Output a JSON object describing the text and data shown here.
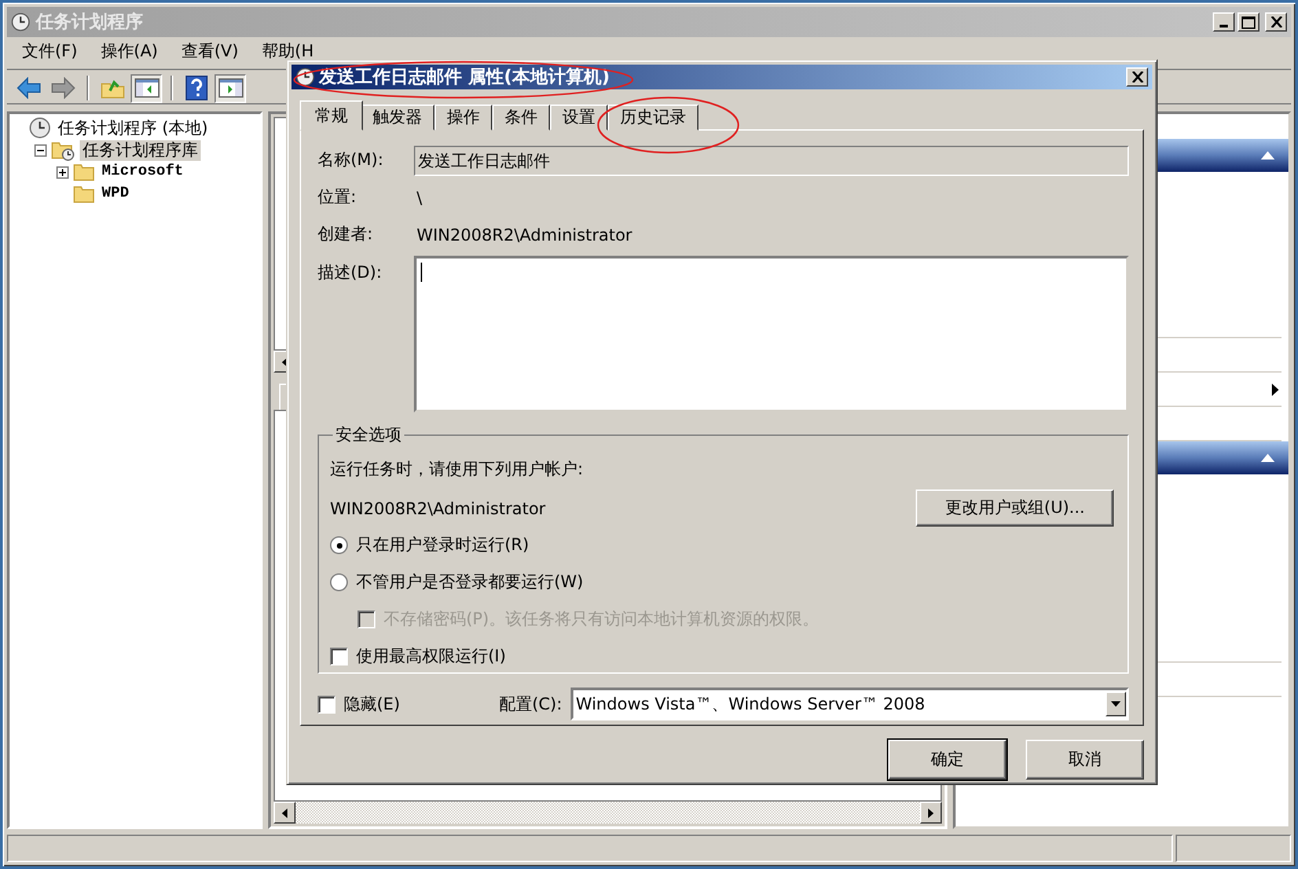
{
  "window": {
    "title": "任务计划程序"
  },
  "menu": [
    "文件(F)",
    "操作(A)",
    "查看(V)",
    "帮助(H"
  ],
  "tree": [
    {
      "label": "任务计划程序 (本地)",
      "kind": "root",
      "selected": false,
      "children": [
        {
          "label": "任务计划程序库",
          "kind": "library",
          "expanded": true,
          "selected": true,
          "children": [
            {
              "label": "Microsoft",
              "kind": "folder",
              "expanded": false,
              "selected": false
            },
            {
              "label": "WPD",
              "kind": "folder",
              "selected": false
            }
          ]
        }
      ]
    }
  ],
  "dialog": {
    "title": "发送工作日志邮件 属性(本地计算机)",
    "title_highlighted": true,
    "tabs": [
      {
        "label": "常规",
        "selected": true,
        "highlighted": false
      },
      {
        "label": "触发器",
        "selected": false,
        "highlighted": false
      },
      {
        "label": "操作",
        "selected": false,
        "highlighted": false
      },
      {
        "label": "条件",
        "selected": false,
        "highlighted": false
      },
      {
        "label": "设置",
        "selected": false,
        "highlighted": false
      },
      {
        "label": "历史记录",
        "selected": false,
        "highlighted": true
      }
    ],
    "name_label": "名称(M):",
    "name_value": "发送工作日志邮件",
    "location_label": "位置:",
    "location_value": "\\",
    "author_label": "创建者:",
    "author_value": "WIN2008R2\\Administrator",
    "description_label": "描述(D):",
    "security": {
      "title": "安全选项",
      "prompt": "运行任务时，请使用下列用户帐户:",
      "account": "WIN2008R2\\Administrator",
      "change_button": "更改用户或组(U)...",
      "options": [
        {
          "kind": "radio",
          "label": "只在用户登录时运行(R)",
          "selected": true,
          "disabled": false
        },
        {
          "kind": "radio",
          "label": "不管用户是否登录都要运行(W)",
          "selected": false,
          "disabled": false,
          "children": [
            {
              "kind": "checkbox",
              "label": "不存储密码(P)。该任务将只有访问本地计算机资源的权限。",
              "checked": false,
              "disabled": true
            }
          ]
        },
        {
          "kind": "checkbox",
          "label": "使用最高权限运行(I)",
          "checked": false,
          "disabled": false
        }
      ]
    },
    "hidden": {
      "label": "隐藏(E)",
      "checked": false
    },
    "config_label": "配置(C):",
    "config_value": "Windows Vista™、Windows Server™ 2008",
    "buttons": [
      {
        "label": "确定",
        "default": true
      },
      {
        "label": "取消",
        "default": false
      }
    ]
  }
}
